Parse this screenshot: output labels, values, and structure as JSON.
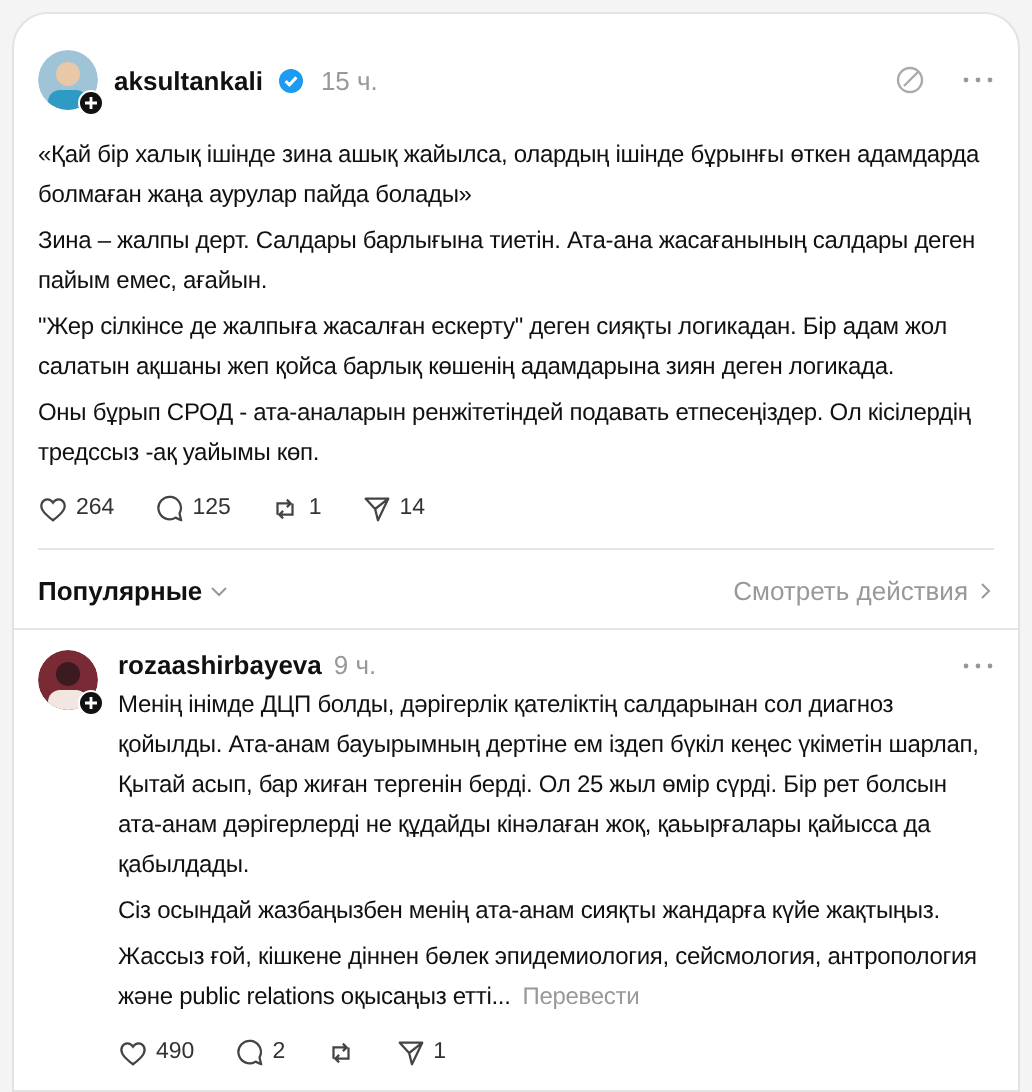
{
  "post": {
    "author": "aksultankali",
    "verified": true,
    "time": "15 ч.",
    "paragraphs": [
      "«Қай бір халық ішінде зина ашық жайылса, олардың ішінде бұрынғы өткен адамдарда болмаған жаңа аурулар пайда болады»",
      "Зина – жалпы дерт. Салдары барлығына тиетін. Ата-ана жасағанының салдары деген пайым емес, ағайын.",
      "\"Жер сілкінсе де жалпыға жасалған ескерту\" деген сияқты логикадан. Бір адам жол салатын ақшаны жеп қойса барлық көшенің адамдарына зиян деген логикада.",
      "Оны бұрып СРОД - ата-аналарын ренжітетіндей подавать етпесеңіздер. Ол кісілердің тредссыз -ақ уайымы көп."
    ],
    "actions": [
      {
        "kind": "like",
        "count": "264"
      },
      {
        "kind": "comment",
        "count": "125"
      },
      {
        "kind": "repost",
        "count": "1"
      },
      {
        "kind": "share",
        "count": "14"
      }
    ]
  },
  "sort": {
    "label": "Популярные",
    "activity_link": "Смотреть действия"
  },
  "replies": [
    {
      "author": "rozaashirbayeva",
      "time": "9 ч.",
      "paragraphs": [
        "Менің інімде ДЦП болды, дәрігерлік қателіктің салдарынан сол диагноз қойылды. Ата-анам бауырымның дертіне ем іздеп бүкіл кеңес үкіметін шарлап, Қытай асып, бар жиған тергенін берді. Ол 25 жыл өмір сүрді. Бір рет болсын ата-анам дәрігерлерді не құдайды кінәлаған жоқ, қаьырғалары қайысса да қабылдады.",
        "Сіз осындай жазбаңызбен менің ата-анам сияқты жандарға күйе жақтыңыз.",
        "Жассыз ғой, кішкене діннен бөлек эпидемиология, сейсмология, антропология және public relations оқысаңыз етті..."
      ],
      "translate": "Перевести",
      "actions": [
        {
          "kind": "like",
          "count": "490"
        },
        {
          "kind": "comment",
          "count": "2"
        },
        {
          "kind": "repost"
        },
        {
          "kind": "share",
          "count": "1"
        }
      ]
    }
  ]
}
